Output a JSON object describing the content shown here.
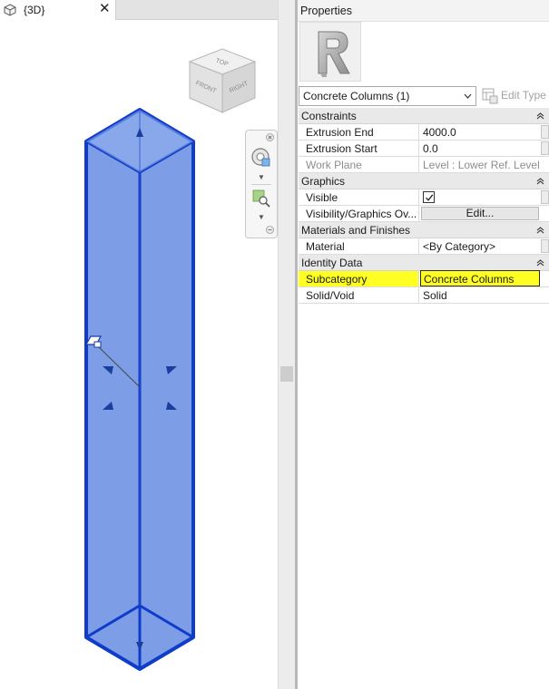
{
  "view_tab": {
    "label": "{3D}",
    "close_glyph": "✕",
    "icon": "3d-view-icon"
  },
  "view_cube": {
    "faces": {
      "top": "TOP",
      "front": "FRONT",
      "right": "RIGHT"
    }
  },
  "nav_bar": {
    "tools": [
      "steering-wheel-icon",
      "zoom-region-icon"
    ]
  },
  "properties": {
    "title": "Properties",
    "type_icon": "revit-family-icon",
    "type_selector": "Concrete Columns (1)",
    "edit_type_label": "Edit Type",
    "groups": {
      "constraints": {
        "label": "Constraints",
        "extrusion_end": {
          "name": "Extrusion End",
          "value": "4000.0"
        },
        "extrusion_start": {
          "name": "Extrusion Start",
          "value": "0.0"
        },
        "work_plane": {
          "name": "Work Plane",
          "value": "Level : Lower Ref. Level"
        }
      },
      "graphics": {
        "label": "Graphics",
        "visible": {
          "name": "Visible",
          "checked": true
        },
        "vis_overrides": {
          "name": "Visibility/Graphics Ov...",
          "button": "Edit..."
        }
      },
      "materials": {
        "label": "Materials and Finishes",
        "material": {
          "name": "Material",
          "value": "<By Category>"
        }
      },
      "identity": {
        "label": "Identity Data",
        "subcategory": {
          "name": "Subcategory",
          "value": "Concrete Columns"
        },
        "solid_void": {
          "name": "Solid/Void",
          "value": "Solid"
        }
      }
    }
  },
  "colors": {
    "extrusion_fill": "#7d9ee6",
    "extrusion_edge": "#0f3cc9",
    "highlight": "#ffff23"
  }
}
